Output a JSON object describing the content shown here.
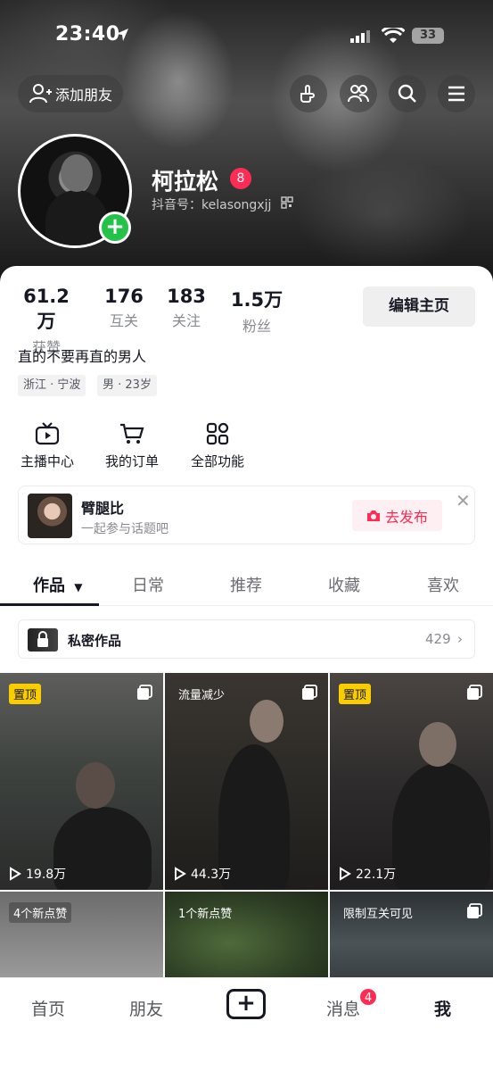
{
  "status_bar": {
    "time": "23:40",
    "battery": "33"
  },
  "top_bar": {
    "add_friend_label": "添加朋友"
  },
  "profile": {
    "name": "柯拉松",
    "name_badge": "8",
    "douyin_id": "抖音号：kelasongxjj",
    "bio": "直的不要再直的男人",
    "tags": [
      "浙江 · 宁波",
      "男 · 23岁"
    ]
  },
  "stats": [
    {
      "value": "61.2万",
      "label": "获赞"
    },
    {
      "value": "176",
      "label": "互关"
    },
    {
      "value": "183",
      "label": "关注"
    },
    {
      "value": "1.5万",
      "label": "粉丝"
    }
  ],
  "edit_button": "编辑主页",
  "quick_actions": [
    {
      "label": "主播中心",
      "icon": "tv-icon"
    },
    {
      "label": "我的订单",
      "icon": "cart-icon"
    },
    {
      "label": "全部功能",
      "icon": "grid-icon"
    }
  ],
  "promo": {
    "title": "臂腿比",
    "subtitle": "一起参与话题吧",
    "button": "去发布"
  },
  "tabs": [
    "作品",
    "日常",
    "推荐",
    "收藏",
    "喜欢"
  ],
  "private_works": {
    "label": "私密作品",
    "count": "429"
  },
  "videos": [
    {
      "badge": "置顶",
      "badge_type": "pin",
      "views": "19.8万"
    },
    {
      "badge": "流量减少",
      "badge_type": "text",
      "views": "44.3万"
    },
    {
      "badge": "置顶",
      "badge_type": "pin",
      "views": "22.1万"
    },
    {
      "badge": "4个新点赞",
      "badge_type": "text",
      "views": ""
    },
    {
      "badge": "1个新点赞",
      "badge_type": "text",
      "views": ""
    },
    {
      "badge": "限制互关可见",
      "badge_type": "text",
      "views": ""
    }
  ],
  "bottom_nav": [
    {
      "label": "首页"
    },
    {
      "label": "朋友"
    },
    {
      "label": "+"
    },
    {
      "label": "消息",
      "badge": "4"
    },
    {
      "label": "我"
    }
  ],
  "colors": {
    "accent": "#fe2c55",
    "pin": "#facd00",
    "online": "#25c24a"
  }
}
